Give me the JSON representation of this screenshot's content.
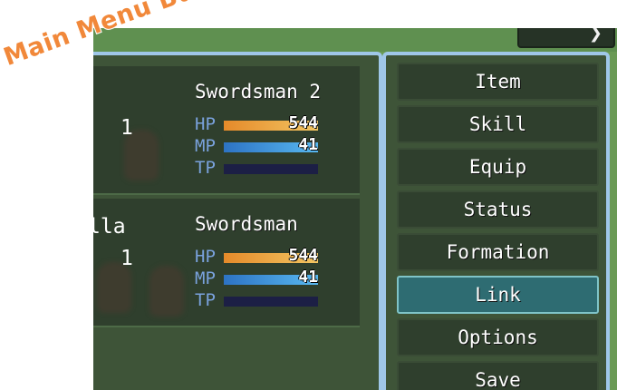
{
  "annotation": "Main Menu Button",
  "actors": [
    {
      "name": "Swordsman 2",
      "level": "1",
      "clipped_name": "",
      "hp": {
        "label": "HP",
        "value": "544",
        "fill": 1.0
      },
      "mp": {
        "label": "MP",
        "value": "41",
        "fill": 1.0
      },
      "tp": {
        "label": "TP",
        "value": "",
        "fill": 0.0
      }
    },
    {
      "name": "Swordsman",
      "level": "1",
      "clipped_name": "lla",
      "hp": {
        "label": "HP",
        "value": "544",
        "fill": 1.0
      },
      "mp": {
        "label": "MP",
        "value": "41",
        "fill": 1.0
      },
      "tp": {
        "label": "TP",
        "value": "",
        "fill": 0.0
      }
    }
  ],
  "commands": [
    {
      "label": "Item",
      "selected": false
    },
    {
      "label": "Skill",
      "selected": false
    },
    {
      "label": "Equip",
      "selected": false
    },
    {
      "label": "Status",
      "selected": false
    },
    {
      "label": "Formation",
      "selected": false
    },
    {
      "label": "Link",
      "selected": true
    },
    {
      "label": "Options",
      "selected": false
    },
    {
      "label": "Save",
      "selected": false
    }
  ],
  "top_button_icon": "close-icon"
}
